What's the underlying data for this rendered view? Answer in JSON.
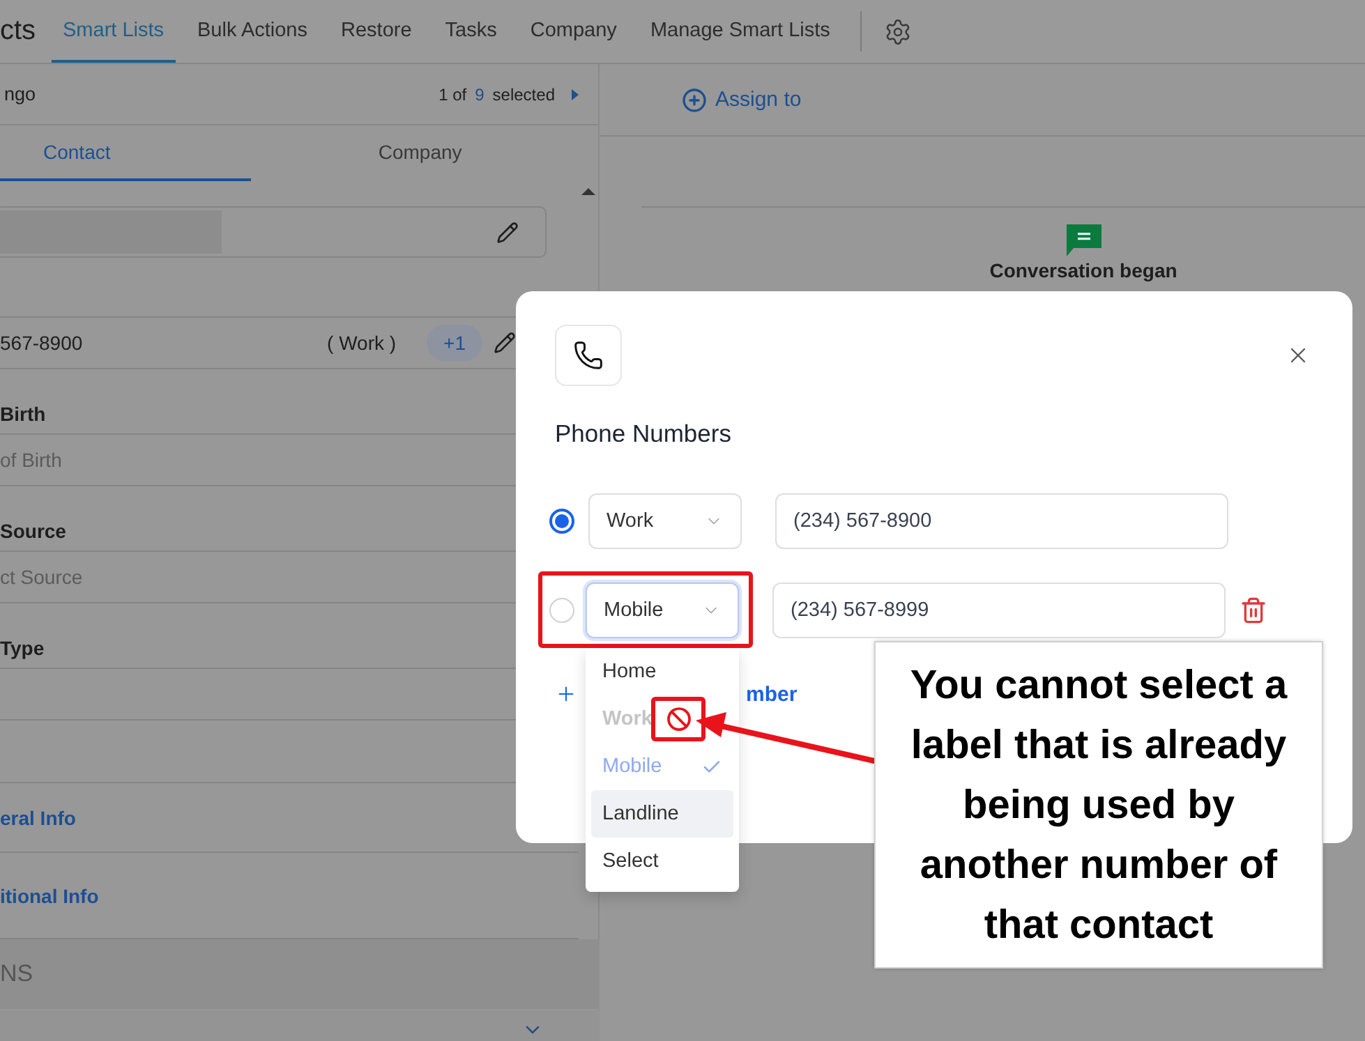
{
  "nav": {
    "title": "cts",
    "tabs": [
      {
        "label": "Smart Lists",
        "selected": true
      },
      {
        "label": "Bulk Actions",
        "selected": false
      },
      {
        "label": "Restore",
        "selected": false
      },
      {
        "label": "Tasks",
        "selected": false
      },
      {
        "label": "Company",
        "selected": false
      },
      {
        "label": "Manage Smart Lists",
        "selected": false
      }
    ]
  },
  "left": {
    "header": {
      "name": "ngo",
      "count_prefix": "1 of",
      "count": "9",
      "count_suffix": "selected"
    },
    "tabs": [
      {
        "label": "Contact",
        "selected": true
      },
      {
        "label": "Company",
        "selected": false
      }
    ],
    "phone": {
      "number": "567-8900",
      "label": "( Work )",
      "extra": "+1"
    },
    "fields": [
      {
        "kind": "input",
        "label": "Birth",
        "placeholder": "of Birth"
      },
      {
        "kind": "input",
        "label": "Source",
        "placeholder": "ct Source"
      },
      {
        "kind": "select",
        "label": "Type"
      }
    ],
    "sections": [
      {
        "label": "eral Info"
      },
      {
        "label": "itional Info"
      }
    ],
    "group_title": "NS"
  },
  "right": {
    "assign": "Assign to",
    "event": "Conversation began"
  },
  "modal": {
    "title": "Phone Numbers",
    "numbers": [
      {
        "primary": true,
        "label": "Work",
        "value": "(234) 567-8900",
        "focused": false,
        "deletable": false
      },
      {
        "primary": false,
        "label": "Mobile",
        "value": "(234) 567-8999",
        "focused": true,
        "deletable": true
      }
    ],
    "add_link": "mber",
    "dropdown": [
      {
        "label": "Home",
        "disabled": false,
        "selected": false,
        "highlighted": false
      },
      {
        "label": "Work",
        "disabled": true,
        "selected": false,
        "highlighted": false
      },
      {
        "label": "Mobile",
        "disabled": false,
        "selected": true,
        "highlighted": false
      },
      {
        "label": "Landline",
        "disabled": false,
        "selected": false,
        "highlighted": true
      },
      {
        "label": "Select",
        "disabled": false,
        "selected": false,
        "highlighted": false
      }
    ]
  },
  "callout": {
    "text": "You cannot select a label that is already being used by another number of that contact"
  }
}
